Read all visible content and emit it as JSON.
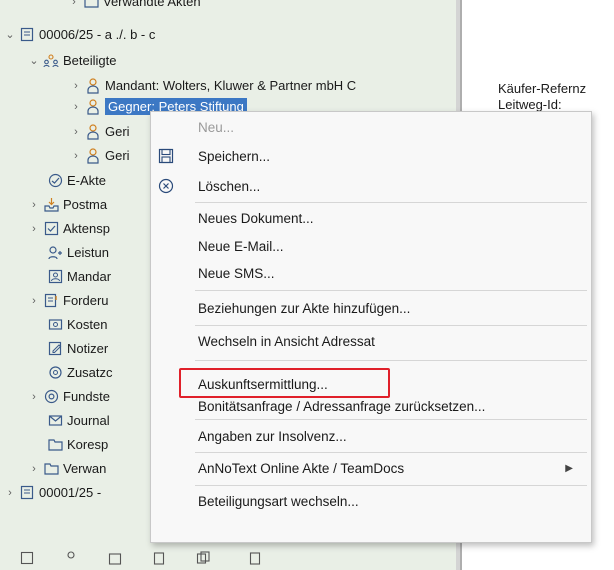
{
  "tree": {
    "rows": [
      {
        "label": "Verwandte Akten",
        "icon": "folder-icon"
      },
      {
        "label": "00006/25 - a ./. b - c",
        "icon": "case-file-icon"
      },
      {
        "label": "Beteiligte",
        "icon": "people-icon"
      },
      {
        "label": "Mandant: Wolters, Kluwer & Partner mbH C",
        "icon": "person-icon"
      },
      {
        "label": "Gegner: Peters Stiftung",
        "icon": "person-icon"
      },
      {
        "label": "Geri",
        "icon": "person-icon"
      },
      {
        "label": "Geri",
        "icon": "person-icon"
      },
      {
        "label": "E-Akte",
        "icon": "e-file-icon"
      },
      {
        "label": "Postma",
        "icon": "inbox-icon"
      },
      {
        "label": "Aktensp",
        "icon": "checkbox-icon"
      },
      {
        "label": "Leistun",
        "icon": "services-icon"
      },
      {
        "label": "Mandar",
        "icon": "client-icon"
      },
      {
        "label": "Forderu",
        "icon": "claims-icon"
      },
      {
        "label": "Kosten",
        "icon": "costs-icon"
      },
      {
        "label": "Notizer",
        "icon": "notes-icon"
      },
      {
        "label": "Zusatzc",
        "icon": "extra-data-icon"
      },
      {
        "label": "Fundste",
        "icon": "at-icon"
      },
      {
        "label": "Journal",
        "icon": "journal-icon"
      },
      {
        "label": "Koresp",
        "icon": "folder-icon"
      },
      {
        "label": "Verwan",
        "icon": "folder-icon"
      },
      {
        "label": "00001/25 -",
        "icon": "case-file-icon"
      }
    ]
  },
  "details": {
    "kaeufer_referenz": "Käufer-Refernz",
    "leitweg_id": "Leitweg-Id:"
  },
  "context_menu": {
    "items": [
      {
        "label": "Neu...",
        "disabled": true
      },
      {
        "label": "Speichern...",
        "icon": "save-icon"
      },
      {
        "label": "Löschen...",
        "icon": "delete-icon"
      },
      {
        "label": "Neues Dokument..."
      },
      {
        "label": "Neue E-Mail..."
      },
      {
        "label": "Neue SMS..."
      },
      {
        "label": "Beziehungen zur Akte hinzufügen..."
      },
      {
        "label": "Wechseln in Ansicht Adressat"
      },
      {
        "label": "Auskunftsermittlung..."
      },
      {
        "label": "Bonitätsanfrage / Adressanfrage zurücksetzen..."
      },
      {
        "label": "Angaben zur Insolvenz..."
      },
      {
        "label": "AnNoText Online Akte / TeamDocs",
        "submenu": true
      },
      {
        "label": "Beteiligungsart wechseln..."
      }
    ]
  },
  "colors": {
    "tree_bg": "#e9efe6",
    "selection": "#3c78c4",
    "highlight_box": "#e0202a"
  }
}
